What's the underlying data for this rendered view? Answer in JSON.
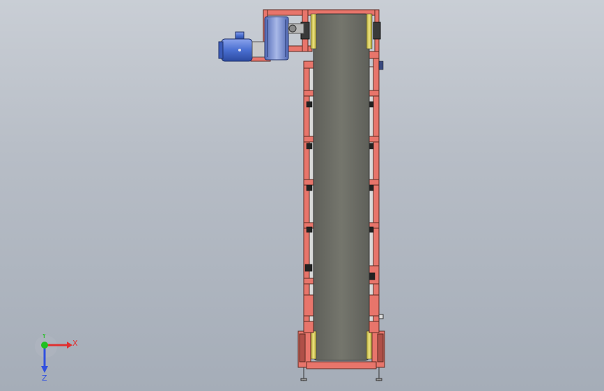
{
  "viewport": {
    "background_top": "#c9ced5",
    "background_bottom": "#a5adb8"
  },
  "model": {
    "frame_color": "#e8756b",
    "frame_edge": "#5a2a22",
    "belt_color": "#6e6f66",
    "pulley_color": "#d8cc60",
    "motor_color": "#4a6fd1",
    "gearbox_color": "#6f86c9"
  },
  "triad": {
    "x_label": "X",
    "y_label": "Y",
    "z_label": "Z",
    "x_color": "#e03030",
    "y_color": "#20c020",
    "z_color": "#3050e0"
  }
}
